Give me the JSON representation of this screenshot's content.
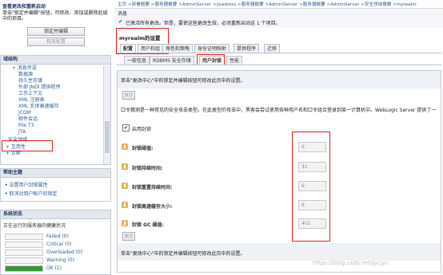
{
  "left": {
    "change_center": {
      "title": "查看更改和重新启动",
      "desc": "单击\"锁定并编辑\"按钮，可修改、添加或删除此域中的项目。",
      "lock_button": "锁定并编辑",
      "release_button": "释放配置"
    },
    "domain_structure": {
      "title": "域结构",
      "items": [
        {
          "label": "+ 消息传送",
          "indent": 2
        },
        {
          "label": "数据源",
          "indent": 3
        },
        {
          "label": "持久性存储",
          "indent": 3
        },
        {
          "label": "外部 JNDI 提供程序",
          "indent": 3
        },
        {
          "label": "工作上下文",
          "indent": 3
        },
        {
          "label": "XML 注册表",
          "indent": 3
        },
        {
          "label": "XML 实体高速缓存",
          "indent": 3
        },
        {
          "label": "jCOM",
          "indent": 3
        },
        {
          "label": "邮件会话",
          "indent": 3
        },
        {
          "label": "File T3",
          "indent": 3
        },
        {
          "label": "JTA",
          "indent": 3
        },
        {
          "label": "安全领域",
          "indent": 1
        },
        {
          "label": "+ 互用性",
          "indent": 1
        },
        {
          "label": "+ 诊断",
          "indent": 1
        }
      ]
    },
    "help": {
      "title": "帮助主题",
      "items": [
        "设置用户封锁属性",
        "取消对用户帐户的锁定"
      ]
    },
    "system_status": {
      "title": "系统状态",
      "subtitle": "正在运行的服务器的健康状况",
      "rows": [
        {
          "label": "Failed (0)",
          "color": "#cc0000",
          "fill": 0.0
        },
        {
          "label": "Critical (0)",
          "color": "#cc3300",
          "fill": 0.0
        },
        {
          "label": "Overloaded (0)",
          "color": "#e0a000",
          "fill": 0.0
        },
        {
          "label": "Warning (0)",
          "color": "#e0d000",
          "fill": 0.0
        },
        {
          "label": "OK (1)",
          "color": "#339933",
          "fill": 1.0
        }
      ]
    }
  },
  "main": {
    "breadcrumb": "主页 >部署概要 >服务器概要 >AdminServer >zyadress >服务器概要 >AdminServer >服务器概要 >AdminServer >安全领域概要 >myrealm",
    "messages_title": "消息",
    "message": "已激活所有更改。但是，要使这些更改生效，必须重新启动这 1 个项目。",
    "page_title": "myrealm的设置",
    "tabs_top": [
      "配置",
      "用户和组",
      "角色和策略",
      "身份证明映射",
      "提供程序",
      "迁移"
    ],
    "tabs_sub": [
      "一般信息",
      "RDBMS 安全存储",
      "用户封锁",
      "性能"
    ],
    "hint_top": "单击\"更改中心\"中的锁定并编辑按钮可修改此页中的设置。",
    "save_button": "保存",
    "description": "口令猜测是一种常见的安全攻击类型。在此类型的攻击中，黑客会尝试使用各种用户名和口令组合登录到某一计算机中。WebLogic Server 提供了一",
    "enable_label": "启用封锁",
    "fields": [
      {
        "label": "封锁阈值:",
        "value": "6"
      },
      {
        "label": "封锁持续时间:",
        "value": "31"
      },
      {
        "label": "封锁重置持续时间:",
        "value": "6"
      },
      {
        "label": "封锁高速缓存大小:",
        "value": "6"
      },
      {
        "label": "封锁 GC 阈值:",
        "value": "401"
      }
    ],
    "hint_bottom": "单击\"更改中心\"中的锁定并编辑按钮可修改此页中的设置。",
    "watermark": "https://blog.csdn.net/jycjyc"
  },
  "colors": {
    "highlight": "#e0201b",
    "link": "#2b5a9c",
    "panel_header": "#e4e8ee"
  }
}
